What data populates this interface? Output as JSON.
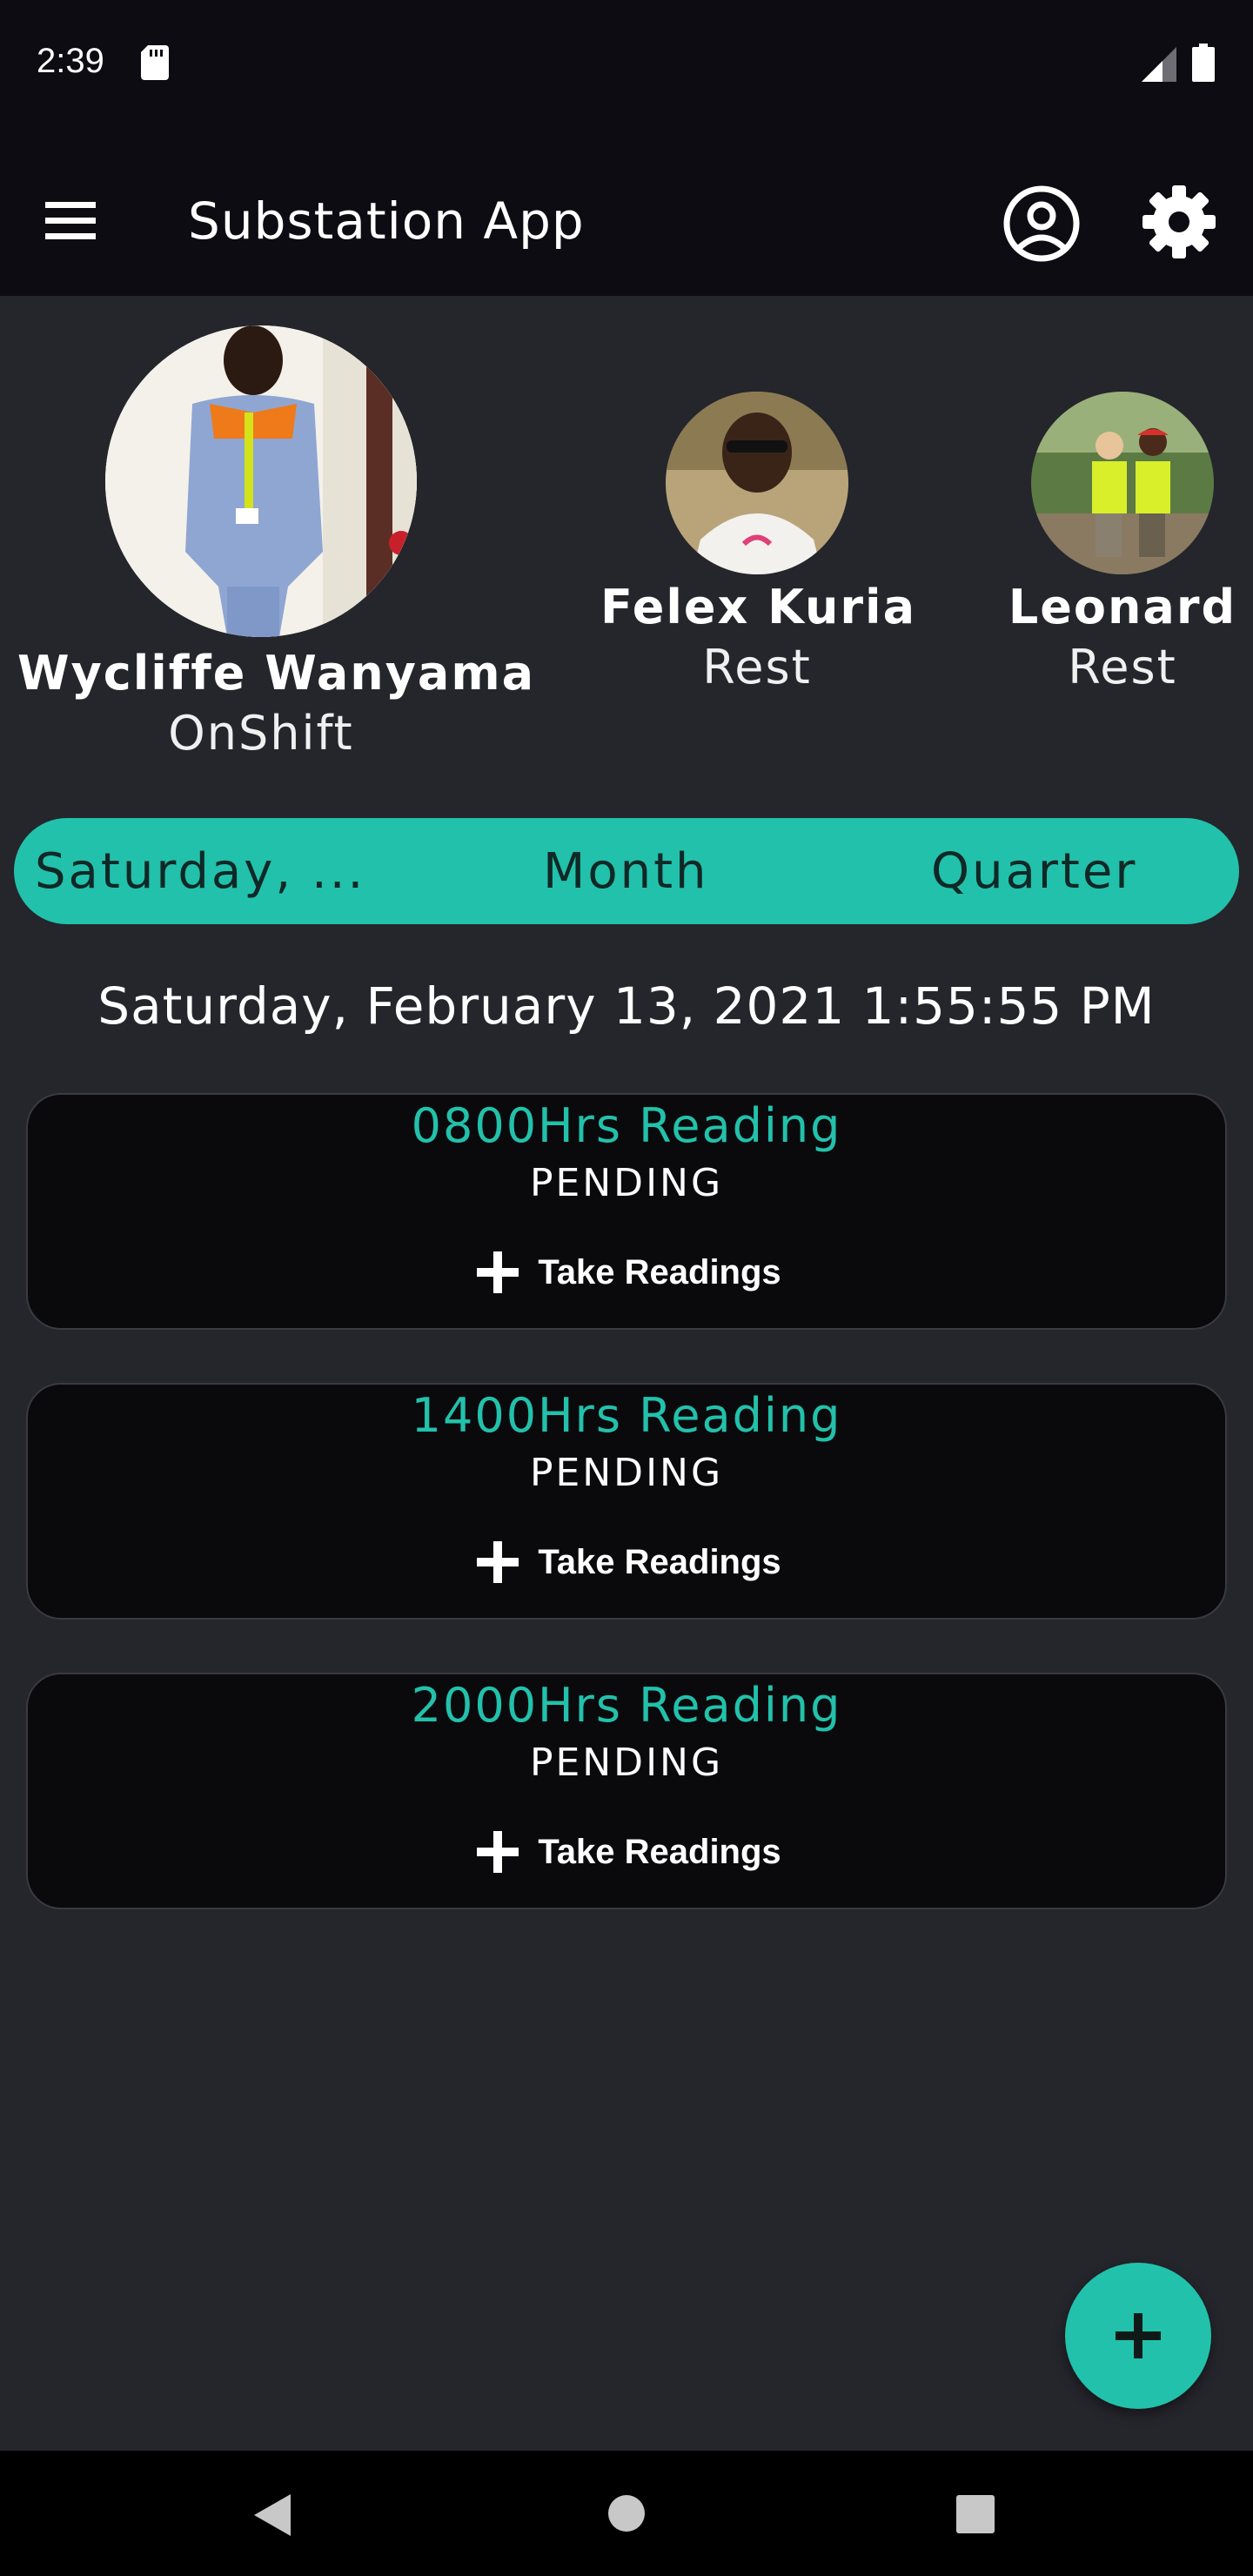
{
  "status_bar": {
    "time": "2:39",
    "icons": [
      "sd-card-icon",
      "signal-icon",
      "battery-icon"
    ]
  },
  "app_bar": {
    "title": "Substation App",
    "icons": [
      "menu-icon",
      "account-circle-icon",
      "settings-icon"
    ]
  },
  "staff": [
    {
      "name": "Wycliffe Wanyama",
      "status": "OnShift"
    },
    {
      "name": "Felex Kuria",
      "status": "Rest"
    },
    {
      "name": "Leonard",
      "status": "Rest"
    }
  ],
  "period_tabs": [
    "Saturday, ...",
    "Month",
    "Quarter"
  ],
  "current_datetime": "Saturday, February 13, 2021 1:55:55 PM",
  "readings": [
    {
      "title": "0800Hrs Reading",
      "status": "PENDING",
      "action": "Take Readings"
    },
    {
      "title": "1400Hrs Reading",
      "status": "PENDING",
      "action": "Take Readings"
    },
    {
      "title": "2000Hrs Reading",
      "status": "PENDING",
      "action": "Take Readings"
    }
  ],
  "colors": {
    "accent": "#22c1ab",
    "background": "#25252c",
    "bar": "#0c0c12",
    "card": "#0a0a0c"
  }
}
